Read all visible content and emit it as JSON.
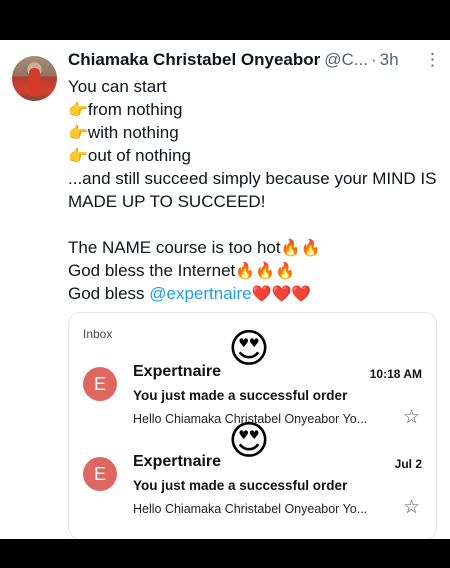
{
  "tweet": {
    "author_name": "Chiamaka Christabel Onyeabor",
    "author_handle": "@C...",
    "dot": "·",
    "time": "3h",
    "more": "⋮",
    "lines": [
      "You can start",
      "from nothing",
      "with nothing",
      "out of nothing",
      "...and still succeed simply because your MIND IS MADE UP TO SUCCEED!",
      "The NAME course is too hot",
      "God bless the Internet",
      "God bless "
    ],
    "mention": "@expertnaire",
    "emojis": {
      "pointing": "👉",
      "fire2": "🔥🔥",
      "fire3": "🔥🔥🔥",
      "hearts": "❤️❤️❤️",
      "heart_eyes": "😍"
    }
  },
  "card": {
    "inbox_label": "Inbox",
    "emails": [
      {
        "initial": "E",
        "sender": "Expertnaire",
        "date": "10:18 AM",
        "subject": "You just made a successful order",
        "preview": "Hello Chiamaka Christabel Onyeabor Yo...",
        "star": "☆"
      },
      {
        "initial": "E",
        "sender": "Expertnaire",
        "date": "Jul 2",
        "subject": "You just made a successful order",
        "preview": "Hello Chiamaka Christabel Onyeabor Yo...",
        "star": "☆"
      }
    ]
  },
  "colors": {
    "mention": "#1d9bf0",
    "email_avatar": "#e0675f"
  }
}
